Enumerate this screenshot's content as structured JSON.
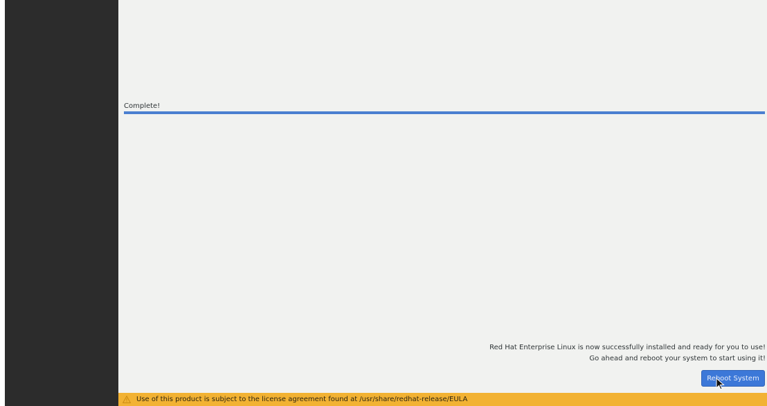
{
  "installer": {
    "status_text": "Complete!",
    "progress": 1.0,
    "success_message_line1": "Red Hat Enterprise Linux is now successfully installed and ready for you to use!",
    "success_message_line2": "Go ahead and reboot your system to start using it!",
    "reboot_button_label": "Reboot System"
  },
  "eula_bar": {
    "icon": "warning-icon",
    "text": "Use of this product is subject to the license agreement found at /usr/share/redhat-release/EULA"
  },
  "colors": {
    "sidebar": "#2c2c2c",
    "background": "#f1f2f0",
    "progress": "#4a7fd0",
    "button": "#3c78d8",
    "warning_bar": "#f2b233"
  }
}
